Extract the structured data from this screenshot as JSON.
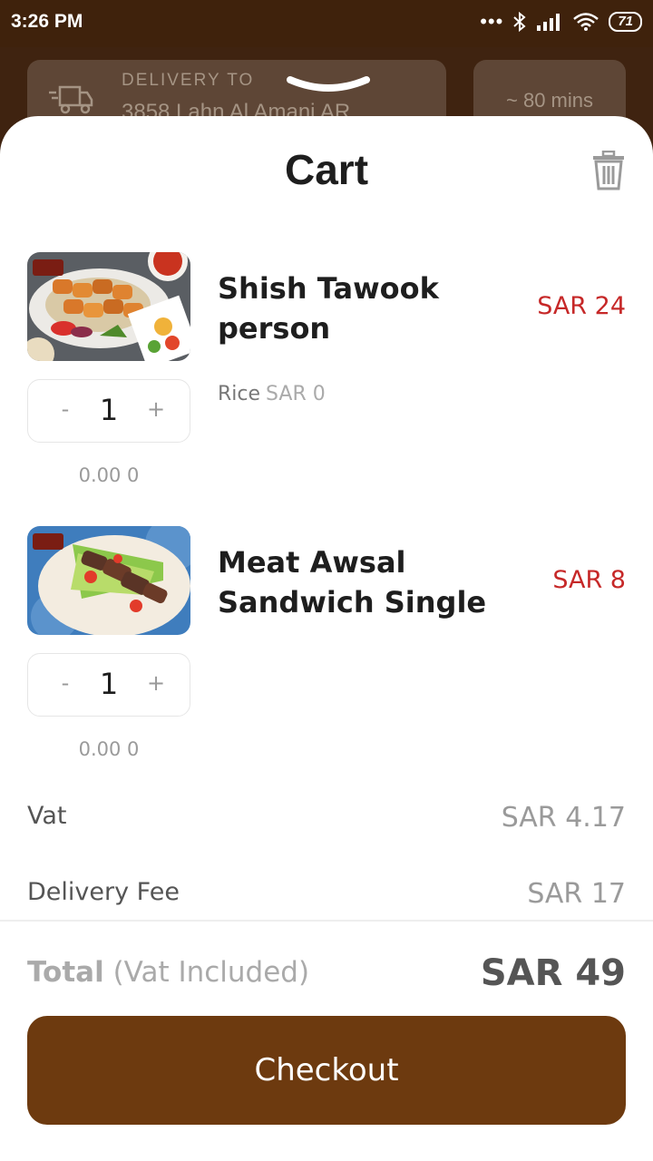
{
  "status_bar": {
    "time": "3:26 PM",
    "dots": "•••",
    "battery": "71"
  },
  "header": {
    "delivery_label": "DELIVERY TO",
    "delivery_address": "3858 Lahn Al Amani AR",
    "eta": "~ 80 mins"
  },
  "cart": {
    "title": "Cart",
    "items": [
      {
        "name": "Shish Tawook person",
        "price": "SAR 24",
        "option_name": "Rice",
        "option_price": "SAR 0",
        "quantity": "1",
        "minus": "-",
        "plus": "+",
        "subtotal": "0.00 0",
        "image": "grilled-chicken-skewers-plate"
      },
      {
        "name": "Meat Awsal Sandwich Single",
        "price": "SAR 8",
        "quantity": "1",
        "minus": "-",
        "plus": "+",
        "subtotal": "0.00 0",
        "image": "meat-wrap-sandwich"
      }
    ],
    "summary": {
      "vat_label": "Vat",
      "vat_value": "SAR 4.17",
      "delivery_fee_label": "Delivery Fee",
      "delivery_fee_value": "SAR 17",
      "total_label": "Total",
      "total_note": "(Vat Included)",
      "total_value": "SAR 49"
    },
    "checkout_label": "Checkout"
  },
  "colors": {
    "header_brown": "#3f2310",
    "card_brown": "#5e4636",
    "price_red": "#c62828",
    "checkout_brown": "#6d3a0f"
  }
}
